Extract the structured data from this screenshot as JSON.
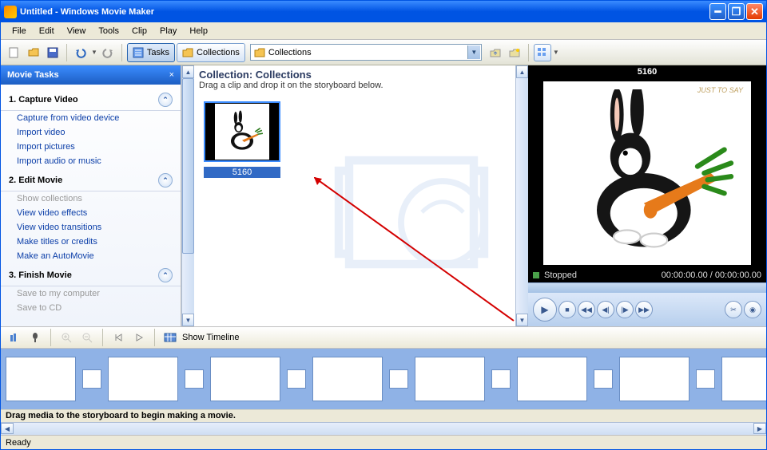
{
  "window": {
    "title": "Untitled - Windows Movie Maker"
  },
  "menu": {
    "items": [
      "File",
      "Edit",
      "View",
      "Tools",
      "Clip",
      "Play",
      "Help"
    ]
  },
  "toolbar": {
    "tasks_label": "Tasks",
    "collections_label": "Collections",
    "combo_value": "Collections"
  },
  "tasks": {
    "header": "Movie Tasks",
    "sections": [
      {
        "title": "1. Capture Video",
        "links": [
          {
            "label": "Capture from video device",
            "dis": false
          },
          {
            "label": "Import video",
            "dis": false
          },
          {
            "label": "Import pictures",
            "dis": false
          },
          {
            "label": "Import audio or music",
            "dis": false
          }
        ]
      },
      {
        "title": "2. Edit Movie",
        "links": [
          {
            "label": "Show collections",
            "dis": true
          },
          {
            "label": "View video effects",
            "dis": false
          },
          {
            "label": "View video transitions",
            "dis": false
          },
          {
            "label": "Make titles or credits",
            "dis": false
          },
          {
            "label": "Make an AutoMovie",
            "dis": false
          }
        ]
      },
      {
        "title": "3. Finish Movie",
        "links": [
          {
            "label": "Save to my computer",
            "dis": true
          },
          {
            "label": "Save to CD",
            "dis": true
          }
        ]
      }
    ]
  },
  "collection": {
    "title": "Collection: Collections",
    "subtitle": "Drag a clip and drop it on the storyboard below.",
    "clip_name": "5160",
    "clip_caption": "JUST TO SAY"
  },
  "preview": {
    "title": "5160",
    "status": "Stopped",
    "time": "00:00:00.00 / 00:00:00.00"
  },
  "storyboard": {
    "show_timeline": "Show Timeline",
    "hint": "Drag media to the storyboard to begin making a movie."
  },
  "status": {
    "text": "Ready"
  }
}
